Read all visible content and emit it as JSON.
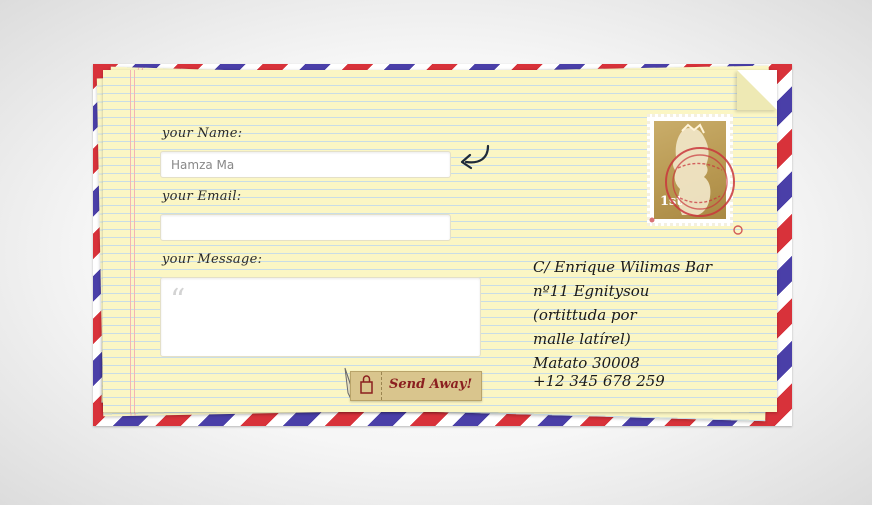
{
  "form": {
    "name_label": "your Name:",
    "name_value": "Hamza Ma",
    "email_label": "your Email:",
    "email_value": "",
    "message_label": "your Message:",
    "message_value": "",
    "quote_glyph": "“",
    "send_label": "Send Away!"
  },
  "address": {
    "lines": [
      "C/ Enrique Wilimas Bar",
      "nº11 Egnitysou",
      "(ortittuda por",
      "malle latírel)",
      "Matato 30008"
    ],
    "phone": "+12 345 678 259"
  },
  "stamp": {
    "value": "1st"
  },
  "colors": {
    "stripe_red": "#d8323a",
    "stripe_blue": "#4a3fa8",
    "paper": "#fbf6c4",
    "send_text": "#8b1f1f",
    "postmark": "#c9363c"
  },
  "icons": [
    "arrow-icon",
    "quote-icon",
    "pen-icon",
    "bag-icon",
    "stamp-icon",
    "postmark-icon"
  ]
}
